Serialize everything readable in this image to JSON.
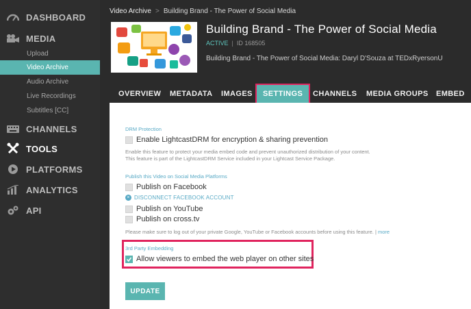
{
  "sidebar": {
    "dashboard": "DASHBOARD",
    "media": "MEDIA",
    "media_items": [
      "Upload",
      "Video Archive",
      "Audio Archive",
      "Live Recordings",
      "Subtitles [CC]"
    ],
    "channels": "CHANNELS",
    "tools": "TOOLS",
    "platforms": "PLATFORMS",
    "analytics": "ANALYTICS",
    "api": "API"
  },
  "breadcrumb": {
    "parent": "Video Archive",
    "separator": ">",
    "current": "Building Brand - The Power of Social Media"
  },
  "video": {
    "title": "Building Brand - The Power of Social Media",
    "status": "ACTIVE",
    "id_sep": "|",
    "id": "ID 168505",
    "subtitle": "Building Brand - The Power of Social Media: Daryl D'Souza at TEDxRyersonU"
  },
  "tabs": [
    "OVERVIEW",
    "METADATA",
    "IMAGES",
    "SETTINGS",
    "CHANNELS",
    "MEDIA GROUPS",
    "EMBED"
  ],
  "settings": {
    "drm": {
      "label": "DRM Protection",
      "option": "Enable LightcastDRM for encryption & sharing prevention",
      "note1": "Enable this feature to protect your media embed code and prevent unauthorized distribution of your content.",
      "note2": "This feature is part of the LightcastDRM Service included in your Lightcast Service Package."
    },
    "social": {
      "label": "Publish this Video on Social Media Platforms",
      "facebook": "Publish on Facebook",
      "disconnect": "DISCONNECT FACEBOOK ACCOUNT",
      "youtube": "Publish on YouTube",
      "crosstv": "Publish on cross.tv",
      "note": "Please make sure to log out of your private Google, YouTube or Facebook accounts before using this feature.",
      "note_sep": "|",
      "more": "more"
    },
    "embedding": {
      "label": "3rd Party Embedding",
      "option": "Allow viewers to embed the web player on other sites",
      "checked": true
    },
    "update_button": "UPDATE"
  },
  "colors": {
    "accent": "#5ab5b0",
    "highlight": "#e0245e",
    "link": "#57a9c5"
  }
}
